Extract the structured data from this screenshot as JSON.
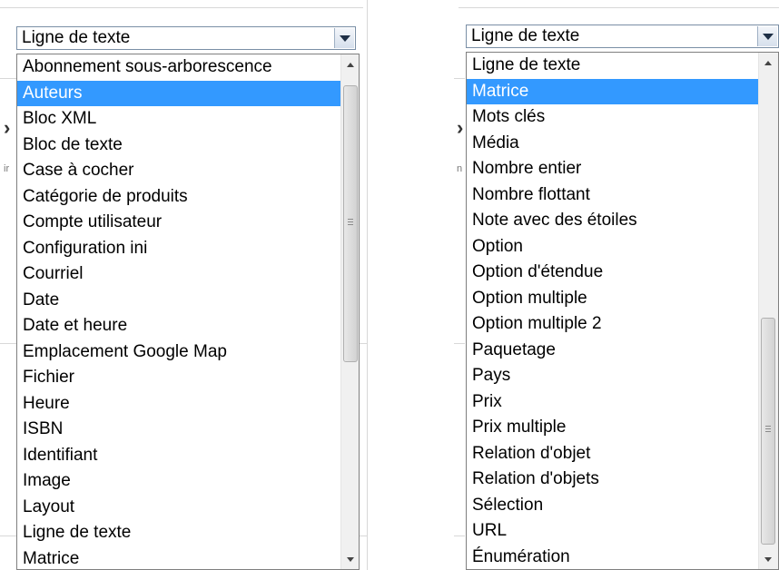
{
  "left_dropdown": {
    "selected_value": "Ligne de texte",
    "highlighted": "Auteurs",
    "options": [
      "Abonnement sous-arborescence",
      "Auteurs",
      "Bloc XML",
      "Bloc de texte",
      "Case à cocher",
      "Catégorie de produits",
      "Compte utilisateur",
      "Configuration ini",
      "Courriel",
      "Date",
      "Date et heure",
      "Emplacement Google Map",
      "Fichier",
      "Heure",
      "ISBN",
      "Identifiant",
      "Image",
      "Layout",
      "Ligne de texte",
      "Matrice"
    ],
    "scroll_position": 0.0
  },
  "right_dropdown": {
    "selected_value": "Ligne de texte",
    "highlighted": "Matrice",
    "options": [
      "Ligne de texte",
      "Matrice",
      "Mots clés",
      "Média",
      "Nombre entier",
      "Nombre flottant",
      "Note avec des étoiles",
      "Option",
      "Option d'étendue",
      "Option multiple",
      "Option multiple 2",
      "Paquetage",
      "Pays",
      "Prix",
      "Prix multiple",
      "Relation d'objet",
      "Relation d'objets",
      "Sélection",
      "URL",
      "Énumération"
    ],
    "scroll_position": 1.0
  },
  "colors": {
    "highlight": "#3399ff",
    "highlight_text": "#ffffff"
  },
  "icons": {
    "dropdown_button": "triangle-down-icon",
    "scroll_up": "triangle-up-icon",
    "scroll_down": "triangle-down-icon"
  },
  "background_glyphs": {
    "left": [
      "ir",
      "›"
    ],
    "right": [
      "n",
      "›"
    ]
  }
}
